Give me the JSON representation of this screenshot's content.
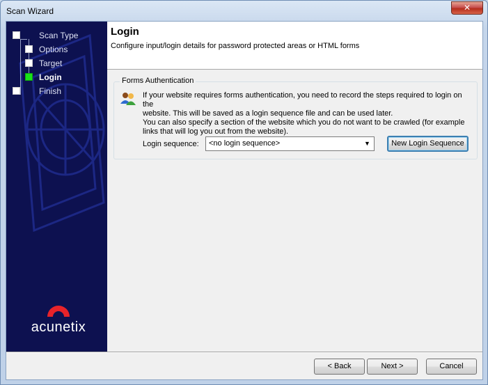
{
  "window": {
    "title": "Scan Wizard",
    "close_glyph": "✕"
  },
  "steps": [
    {
      "label": "Scan Type",
      "active": false
    },
    {
      "label": "Options",
      "active": false
    },
    {
      "label": "Target",
      "active": false
    },
    {
      "label": "Login",
      "active": true
    },
    {
      "label": "Finish",
      "active": false
    }
  ],
  "header": {
    "title": "Login",
    "subtitle": "Configure input/login details for password protected areas or HTML forms"
  },
  "forms_auth": {
    "group_label": "Forms Authentication",
    "info_line1": "If your website requires forms authentication, you need to record the steps required to login on the",
    "info_line2": "website. This will be saved as a login sequence file and can be used later.",
    "info_line3": "You can also specify a section of the website which you do not want to be crawled (for example",
    "info_line4": "links that will log you out from the website).",
    "login_sequence_label": "Login sequence:",
    "login_sequence_value": "<no login sequence>",
    "new_login_button": "New Login Sequence"
  },
  "brand": {
    "name": "acunetix",
    "color": "#e8232a"
  },
  "footer": {
    "back": "< Back",
    "next": "Next >",
    "cancel": "Cancel"
  },
  "icons": {
    "users": "users-icon",
    "dropdown": "chevron-down-icon",
    "close": "close-icon"
  }
}
